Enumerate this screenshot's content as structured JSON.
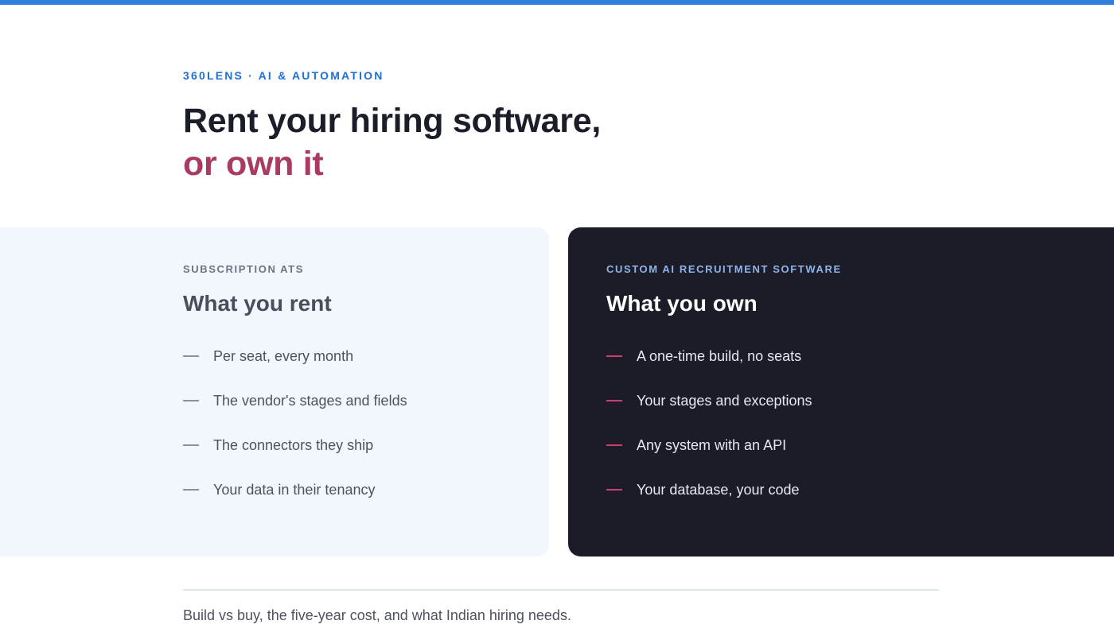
{
  "colors": {
    "top_bar": "#2f7fde",
    "eyebrow": "#1f6fd6",
    "headline": "#1b1d29",
    "headline_accent": "#a83a63",
    "rent_card_bg": "#f2f6fd",
    "own_card_bg": "#1b1c28",
    "own_dash": "#c9406f"
  },
  "hero": {
    "eyebrow": "360LENS · AI & AUTOMATION",
    "title_line1": "Rent your hiring software,",
    "title_line2": "or own it"
  },
  "rent": {
    "eyebrow": "SUBSCRIPTION ATS",
    "title": "What you rent",
    "items": [
      "Per seat, every month",
      "The vendor's stages and fields",
      "The connectors they ship",
      "Your data in their tenancy"
    ]
  },
  "own": {
    "eyebrow": "CUSTOM AI RECRUITMENT SOFTWARE",
    "title": "What you own",
    "items": [
      "A one-time build, no seats",
      "Your stages and exceptions",
      "Any system with an API",
      "Your database, your code"
    ]
  },
  "footer": {
    "note": "Build vs buy, the five-year cost, and what Indian hiring needs."
  }
}
